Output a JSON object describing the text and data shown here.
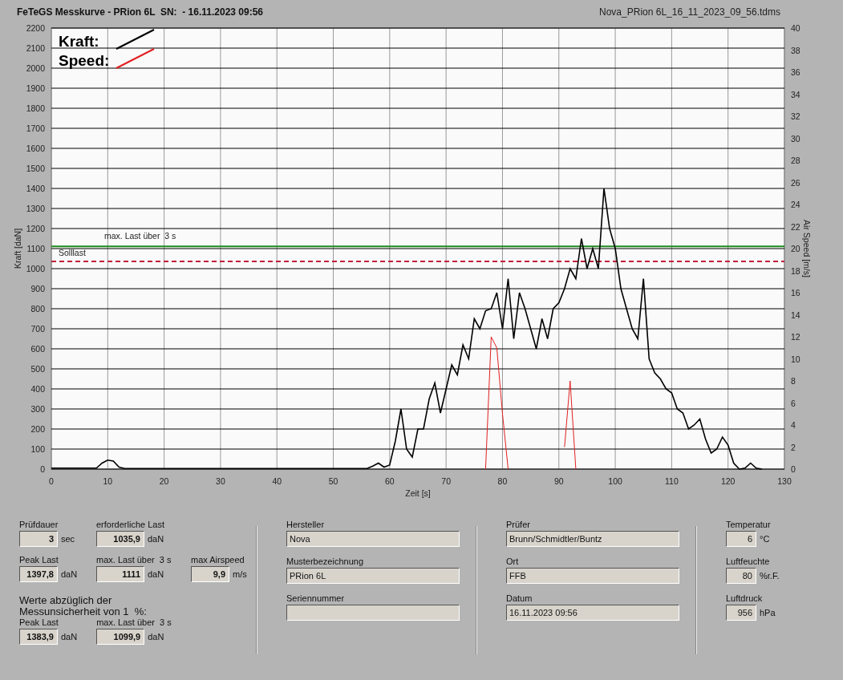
{
  "header": {
    "title": "FeTeGS Messkurve - PRion 6L  SN:  - 16.11.2023 09:56",
    "file": "Nova_PRion 6L_16_11_2023_09_56.tdms"
  },
  "chart": {
    "chart_data": {
      "type": "line",
      "xlabel": "Zeit [s]",
      "ylabel": "Kraft [daN]",
      "y2label": "Air Speed [m/s]",
      "grid": true,
      "legend": "upper left",
      "xlim": [
        0,
        130
      ],
      "ylim": [
        0,
        2200
      ],
      "y2lim": [
        0,
        40
      ],
      "y2ticks": [
        0,
        2,
        4,
        6,
        8,
        10,
        12,
        14,
        16,
        18,
        20,
        22,
        24,
        26,
        28,
        30,
        32,
        34,
        36,
        38,
        40
      ],
      "xticks": [
        0,
        10,
        20,
        30,
        40,
        50,
        60,
        70,
        80,
        90,
        100,
        110,
        120,
        130
      ],
      "yticks": [
        0,
        100,
        200,
        300,
        400,
        500,
        600,
        700,
        800,
        900,
        1000,
        1100,
        1200,
        1300,
        1400,
        1500,
        1600,
        1700,
        1800,
        1900,
        2000,
        2100,
        2200
      ],
      "x": [
        0,
        1,
        2,
        3,
        4,
        5,
        6,
        7,
        8,
        9,
        10,
        11,
        12,
        13,
        14,
        15,
        16,
        17,
        18,
        19,
        20,
        21,
        22,
        23,
        24,
        25,
        26,
        27,
        28,
        29,
        30,
        31,
        32,
        33,
        34,
        35,
        36,
        37,
        38,
        39,
        40,
        41,
        42,
        43,
        44,
        45,
        46,
        47,
        48,
        49,
        50,
        51,
        52,
        53,
        54,
        55,
        56,
        57,
        58,
        59,
        60,
        61,
        62,
        63,
        64,
        65,
        66,
        67,
        68,
        69,
        70,
        71,
        72,
        73,
        74,
        75,
        76,
        77,
        78,
        79,
        80,
        81,
        82,
        83,
        84,
        85,
        86,
        87,
        88,
        89,
        90,
        91,
        92,
        93,
        94,
        95,
        96,
        97,
        98,
        99,
        100,
        101,
        102,
        103,
        104,
        105,
        106,
        107,
        108,
        109,
        110,
        111,
        112,
        113,
        114,
        115,
        116,
        117,
        118,
        119,
        120,
        121,
        122,
        123,
        124,
        125,
        126
      ],
      "series": [
        {
          "name": "Kraft:",
          "color": "#000000",
          "values": [
            5,
            5,
            5,
            5,
            5,
            5,
            5,
            5,
            5,
            30,
            45,
            40,
            10,
            3,
            3,
            3,
            3,
            3,
            3,
            3,
            3,
            3,
            3,
            3,
            3,
            3,
            3,
            3,
            3,
            3,
            3,
            3,
            3,
            3,
            3,
            3,
            3,
            3,
            3,
            3,
            3,
            3,
            3,
            3,
            3,
            3,
            3,
            3,
            3,
            3,
            3,
            3,
            3,
            3,
            3,
            3,
            3,
            15,
            30,
            10,
            20,
            140,
            300,
            100,
            60,
            200,
            200,
            350,
            430,
            280,
            400,
            520,
            470,
            620,
            550,
            750,
            700,
            790,
            800,
            880,
            700,
            950,
            650,
            880,
            800,
            700,
            600,
            750,
            650,
            800,
            830,
            900,
            1000,
            950,
            1150,
            1000,
            1100,
            1000,
            1400,
            1200,
            1100,
            900,
            800,
            700,
            650,
            950,
            550,
            480,
            450,
            400,
            380,
            300,
            280,
            200,
            220,
            250,
            150,
            80,
            100,
            160,
            120,
            30,
            0,
            5,
            30,
            5,
            0
          ]
        },
        {
          "name": "Speed:",
          "color": "#e02020",
          "axis": "y2",
          "values": [
            null,
            null,
            null,
            null,
            null,
            null,
            null,
            null,
            null,
            null,
            null,
            null,
            null,
            null,
            null,
            null,
            null,
            null,
            null,
            null,
            null,
            null,
            null,
            null,
            null,
            null,
            null,
            null,
            null,
            null,
            null,
            null,
            null,
            null,
            null,
            null,
            null,
            null,
            null,
            null,
            null,
            null,
            null,
            null,
            null,
            null,
            null,
            null,
            null,
            null,
            null,
            null,
            null,
            null,
            null,
            null,
            null,
            null,
            null,
            null,
            null,
            null,
            null,
            null,
            null,
            null,
            null,
            null,
            null,
            null,
            null,
            null,
            null,
            null,
            null,
            null,
            null,
            0,
            12,
            11,
            5,
            0,
            null,
            null,
            null,
            null,
            null,
            null,
            null,
            null,
            null,
            2,
            8,
            0,
            null,
            null,
            null,
            null,
            null,
            null,
            null,
            null,
            null,
            null,
            null,
            null,
            null,
            null,
            null,
            null,
            null,
            null,
            null,
            null,
            null,
            null,
            null,
            null,
            null,
            null,
            null,
            null,
            null,
            null,
            null,
            null,
            null
          ]
        }
      ],
      "ref_lines": [
        {
          "axis": "y",
          "value": 1111,
          "label": "max. Last über  3 s",
          "color": "#1e8a1e"
        },
        {
          "axis": "y",
          "value": 1035.9,
          "label": "Solllast",
          "color": "#c0203a"
        }
      ]
    }
  },
  "results": {
    "rows": [
      [
        {
          "label": "Prüfdauer",
          "value": "3",
          "unit": "sec"
        },
        {
          "label": "erforderliche Last",
          "value": "1035,9",
          "unit": "daN"
        }
      ],
      [
        {
          "label": "Peak Last",
          "value": "1397,8",
          "unit": "daN"
        },
        {
          "label": "max. Last über  3 s",
          "value": "1111",
          "unit": "daN"
        },
        {
          "label": "max Airspeed",
          "value": "9,9",
          "unit": "m/s"
        }
      ]
    ],
    "note": "Werte abzüglich der Messunsicherheit von 1  %:",
    "corrected": [
      {
        "label": "Peak Last",
        "value": "1383,9",
        "unit": "daN"
      },
      {
        "label": "max. Last über  3 s",
        "value": "1099,9",
        "unit": "daN"
      }
    ]
  },
  "device": [
    {
      "label": "Hersteller",
      "value": "Nova"
    },
    {
      "label": "Musterbezeichnung",
      "value": "PRion 6L"
    },
    {
      "label": "Seriennummer"
    }
  ],
  "test": [
    {
      "label": "Prüfer",
      "value": "Brunn/Schmidtler/Buntz"
    },
    {
      "label": "Ort",
      "value": "FFB"
    },
    {
      "label": "Datum",
      "value": "16.11.2023 09:56"
    }
  ],
  "environment": [
    {
      "label": "Temperatur",
      "value": "6",
      "unit": "°C"
    },
    {
      "label": "Luftfeuchte",
      "value": "80",
      "unit": "%r.F."
    },
    {
      "label": "Luftdruck",
      "value": "956",
      "unit": "hPa"
    }
  ]
}
